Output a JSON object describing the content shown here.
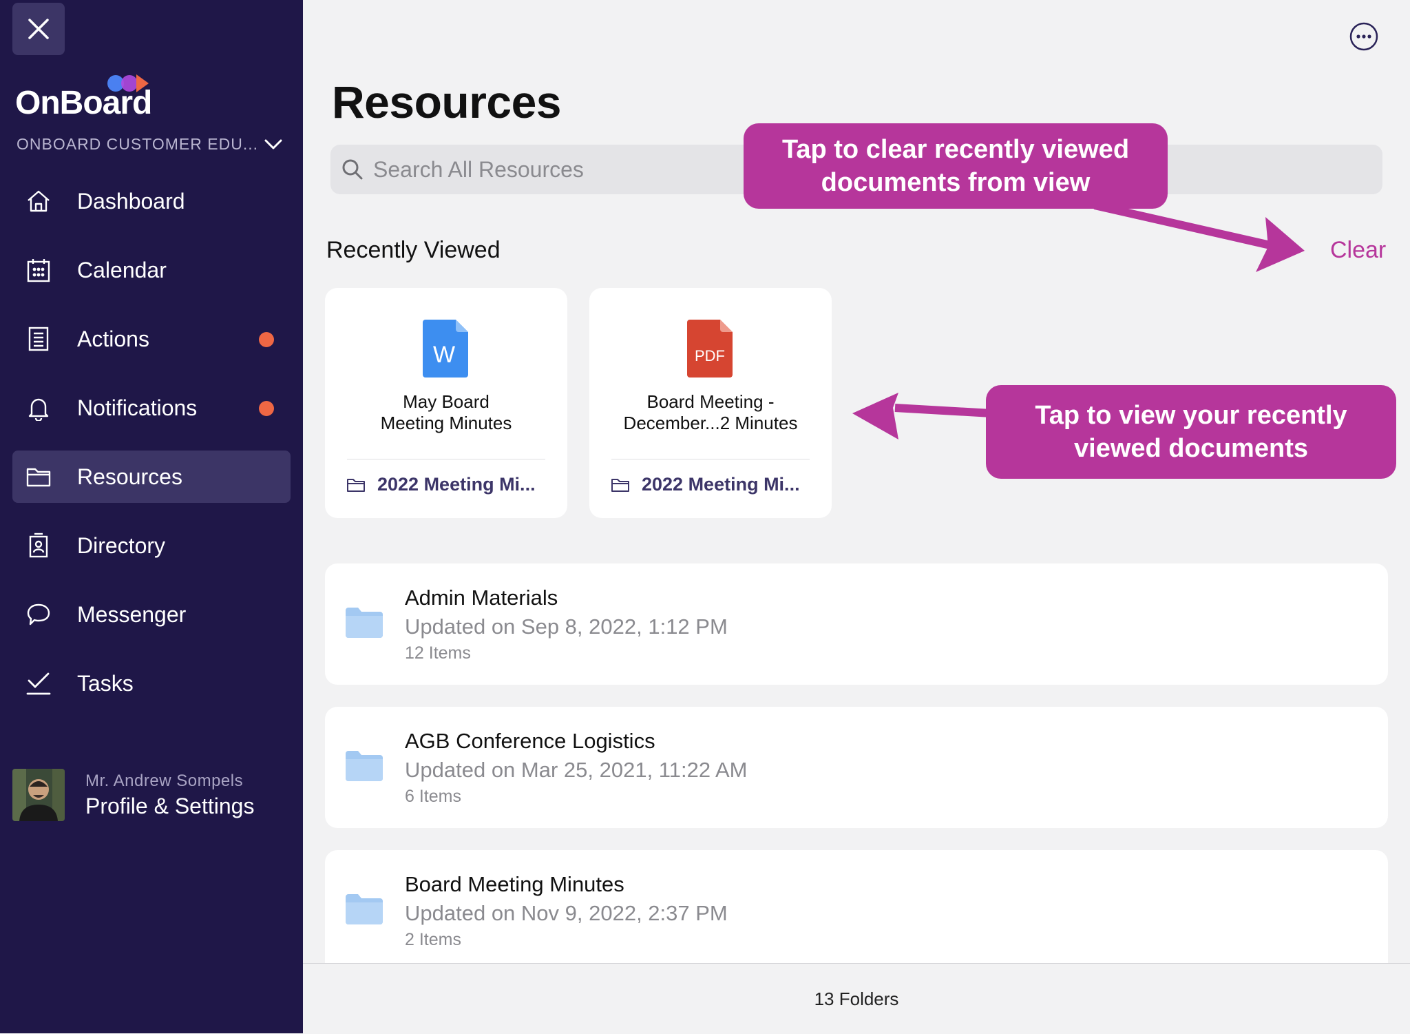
{
  "sidebar": {
    "logo_text": "OnBoard",
    "org_name": "ONBOARD CUSTOMER EDU...",
    "items": [
      {
        "label": "Dashboard"
      },
      {
        "label": "Calendar"
      },
      {
        "label": "Actions",
        "badge": true
      },
      {
        "label": "Notifications",
        "badge": true
      },
      {
        "label": "Resources",
        "active": true
      },
      {
        "label": "Directory"
      },
      {
        "label": "Messenger"
      },
      {
        "label": "Tasks"
      }
    ],
    "profile": {
      "name": "Mr. Andrew Sompels",
      "link_label": "Profile & Settings"
    },
    "colors": {
      "background": "#1f1748",
      "active": "#3c3566",
      "badge": "#ee6744"
    }
  },
  "main": {
    "title": "Resources",
    "search_placeholder": "Search All Resources",
    "recent_section_title": "Recently Viewed",
    "clear_label": "Clear",
    "recent_docs": [
      {
        "icon": "word-doc-icon",
        "icon_label": "W",
        "title_line1": "May Board",
        "title_line2": "Meeting Minutes",
        "folder": "2022 Meeting Mi..."
      },
      {
        "icon": "pdf-doc-icon",
        "icon_label": "PDF",
        "title_line1": "Board Meeting -",
        "title_line2": "December...2 Minutes",
        "folder": "2022 Meeting Mi..."
      }
    ],
    "folders": [
      {
        "name": "Admin Materials",
        "updated": "Updated on Sep 8, 2022, 1:12 PM",
        "count": "12 Items"
      },
      {
        "name": "AGB Conference Logistics",
        "updated": "Updated on Mar 25, 2021, 11:22 AM",
        "count": "6 Items"
      },
      {
        "name": "Board Meeting Minutes",
        "updated": "Updated on Nov 9, 2022, 2:37 PM",
        "count": "2 Items"
      }
    ],
    "footer": "13 Folders"
  },
  "annotations": {
    "clear_callout": {
      "line1": "Tap to clear recently viewed",
      "line2": "documents from view"
    },
    "view_callout": {
      "line1": "Tap to view your recently",
      "line2": "viewed documents"
    },
    "color": "#b6369b"
  }
}
